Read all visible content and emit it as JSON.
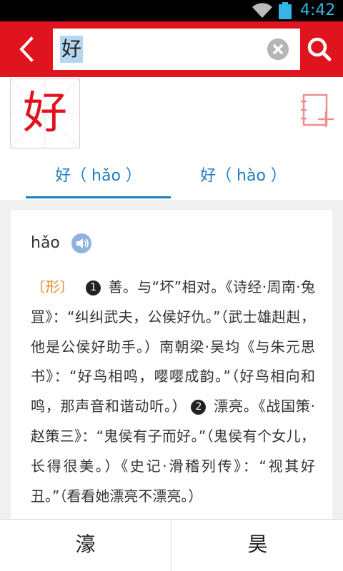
{
  "status_bar": {
    "time": "4:42"
  },
  "header": {
    "search_value": "好"
  },
  "character": {
    "glyph": "好"
  },
  "tabs": [
    {
      "label": "好（ hǎo ）"
    },
    {
      "label": "好（ hào ）"
    }
  ],
  "entry": {
    "pinyin": "hǎo",
    "part_of_speech": "〔形〕",
    "sense_1_number": "1",
    "sense_1_text": "善。与“坏”相对。《诗经·周南·兔罝》：“纠纠武夫，公侯好仇。”（武士雄赳赳，他是公侯好助手。）南朝梁·吴均《与朱元思书》：“好鸟相鸣，嘤嘤成韵。”（好鸟相向和鸣，那声音和谐动听。）",
    "sense_2_number": "2",
    "sense_2_text": "漂亮。《战国策·赵策三》：“鬼侯有子而好。”（鬼侯有个女儿，长得很美。）《史记·滑稽列传》：“视其好丑。”（看看她漂亮不漂亮。）"
  },
  "bottom_nav": {
    "prev_char": "濠",
    "next_char": "昊"
  }
}
